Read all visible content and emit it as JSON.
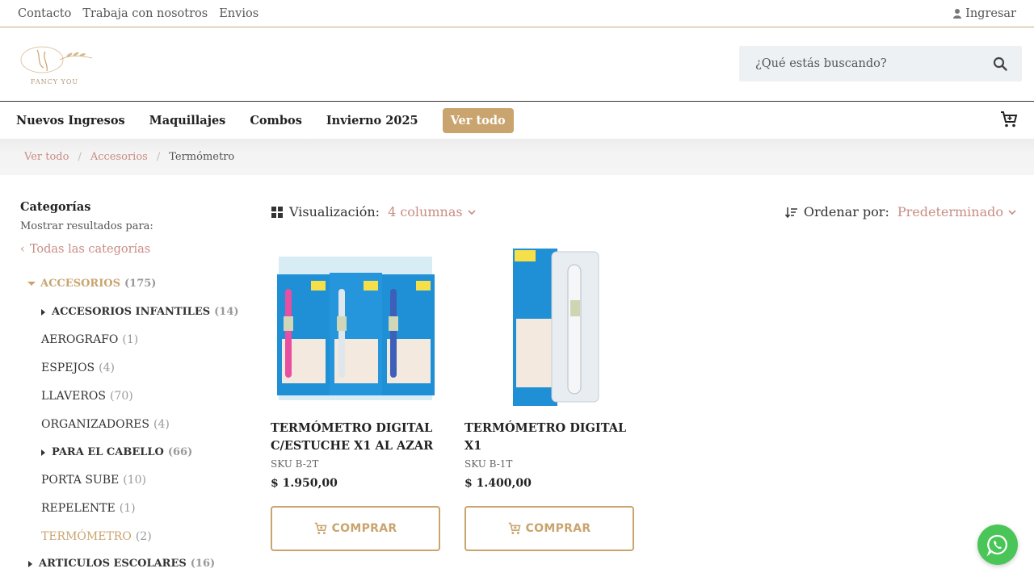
{
  "topbar": {
    "links": [
      "Contacto",
      "Trabaja con nosotros",
      "Envios"
    ],
    "login_label": "Ingresar"
  },
  "header": {
    "logo_text": "FANCY YOU",
    "search_placeholder": "¿Qué estás buscando?"
  },
  "nav": {
    "items": [
      "Nuevos Ingresos",
      "Maquillajes",
      "Combos",
      "Invierno 2025"
    ],
    "highlight": "Ver todo"
  },
  "breadcrumb": {
    "items": [
      "Ver todo",
      "Accesorios"
    ],
    "current": "Termómetro"
  },
  "sidebar": {
    "title": "Categorías",
    "subtitle": "Mostrar resultados para:",
    "all_categories": "Todas las categorías",
    "categories": [
      {
        "label": "ACCESORIOS",
        "count": "(175)"
      },
      {
        "label": "ACCESORIOS INFANTILES",
        "count": "(14)"
      },
      {
        "label": "AEROGRAFO",
        "count": "(1)"
      },
      {
        "label": "ESPEJOS",
        "count": "(4)"
      },
      {
        "label": "LLAVEROS",
        "count": "(70)"
      },
      {
        "label": "ORGANIZADORES",
        "count": "(4)"
      },
      {
        "label": "PARA EL CABELLO",
        "count": "(66)"
      },
      {
        "label": "PORTA SUBE",
        "count": "(10)"
      },
      {
        "label": "REPELENTE",
        "count": "(1)"
      },
      {
        "label": "TERMÓMETRO",
        "count": "(2)"
      },
      {
        "label": "ARTICULOS ESCOLARES",
        "count": "(16)"
      }
    ]
  },
  "toolbar": {
    "view_label": "Visualización:",
    "view_value": "4 columnas",
    "sort_label": "Ordenar por:",
    "sort_value": "Predeterminado"
  },
  "products": [
    {
      "name": "TERMÓMETRO DIGITAL C/ESTUCHE X1 AL AZAR",
      "sku": "SKU B-2T",
      "price": "$  1.950,00",
      "buy_label": "COMPRAR"
    },
    {
      "name": "TERMÓMETRO DIGITAL X1",
      "sku": "SKU B-1T",
      "price": "$  1.400,00",
      "buy_label": "COMPRAR"
    }
  ],
  "colors": {
    "accent_gold": "#c9a46e",
    "link_rose": "#c98c84",
    "whatsapp_green": "#4ac558"
  }
}
